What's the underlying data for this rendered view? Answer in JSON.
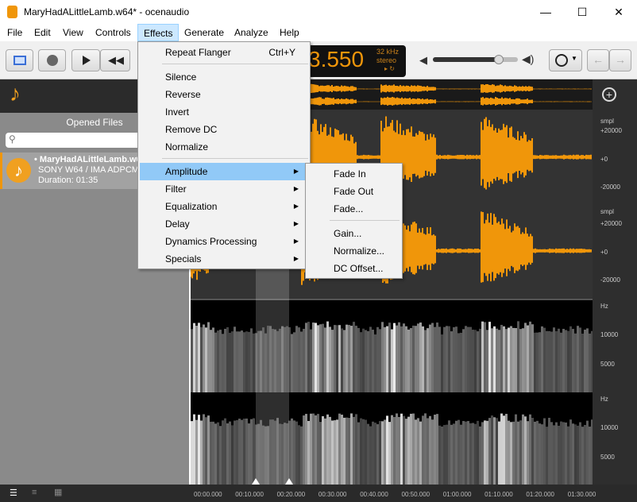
{
  "window": {
    "title": "MaryHadALittleLamb.w64* - ocenaudio",
    "minimize": "—",
    "maximize": "☐",
    "close": "✕"
  },
  "menubar": [
    "File",
    "Edit",
    "View",
    "Controls",
    "Effects",
    "Generate",
    "Analyze",
    "Help"
  ],
  "display": {
    "time": "3.550",
    "rate": "32 kHz",
    "channels": "stereo",
    "volume": 0.78
  },
  "sidebar": {
    "title": "Opened Files",
    "search_placeholder": "",
    "file": {
      "name": "• MaryHadALittleLamb.w64",
      "format": "SONY W64 / IMA ADPCM",
      "duration": "Duration: 01:35"
    }
  },
  "effects_menu": {
    "items": [
      {
        "label": "Repeat Flanger",
        "shortcut": "Ctrl+Y"
      },
      {
        "label": "Silence"
      },
      {
        "label": "Reverse"
      },
      {
        "label": "Invert"
      },
      {
        "label": "Remove DC"
      },
      {
        "label": "Normalize"
      },
      {
        "label": "Amplitude",
        "submenu": true,
        "highlighted": true
      },
      {
        "label": "Filter",
        "submenu": true
      },
      {
        "label": "Equalization",
        "submenu": true
      },
      {
        "label": "Delay",
        "submenu": true
      },
      {
        "label": "Dynamics Processing",
        "submenu": true
      },
      {
        "label": "Specials",
        "submenu": true
      }
    ]
  },
  "amplitude_submenu": [
    "Fade In",
    "Fade Out",
    "Fade...",
    "Gain...",
    "Normalize...",
    "DC Offset..."
  ],
  "ruler": {
    "wave_unit": "smpl",
    "wave_ticks": [
      "+20000",
      "+0",
      "-20000"
    ],
    "spec_unit": "Hz",
    "spec_ticks": [
      "10000",
      "5000"
    ]
  },
  "timeline": [
    "00:00.000",
    "00:10.000",
    "00:20.000",
    "00:30.000",
    "00:40.000",
    "00:50.000",
    "01:00.000",
    "01:10.000",
    "01:20.000",
    "01:30.000"
  ],
  "colors": {
    "accent": "#f0960a",
    "menu_highlight": "#91c9f7"
  }
}
